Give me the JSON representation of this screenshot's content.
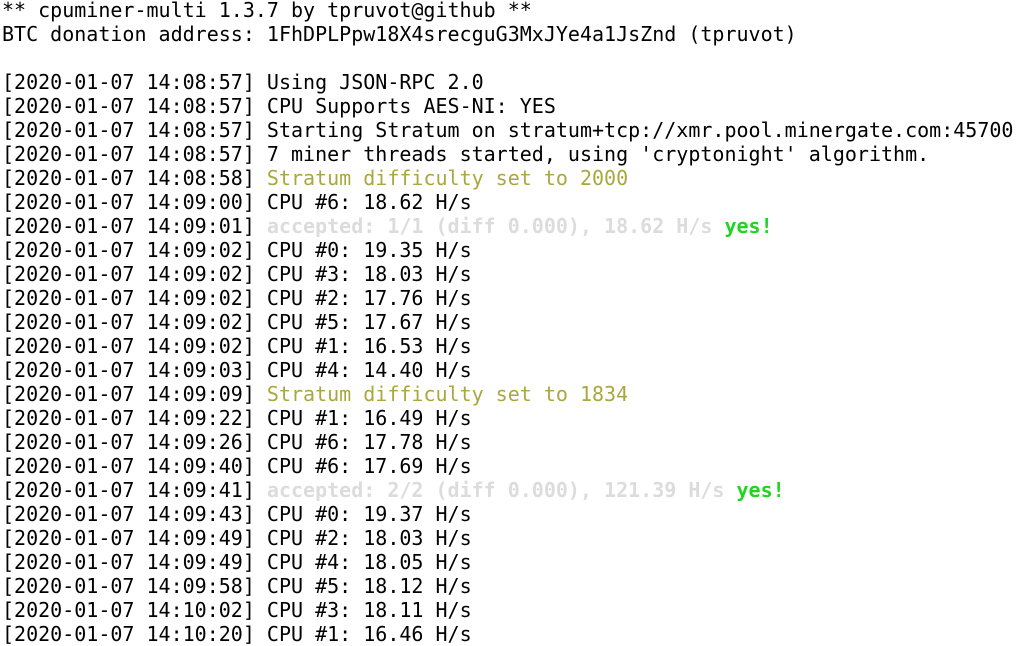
{
  "colors": {
    "normal": "#000000",
    "yellow": "#a9a73f",
    "gray": "#dcdcdc",
    "green": "#1fd51f",
    "background": "#ffffff"
  },
  "lines": [
    [
      {
        "t": "** cpuminer-multi 1.3.7 by tpruvot@github **",
        "c": "normal"
      }
    ],
    [
      {
        "t": "BTC donation address: 1FhDPLPpw18X4srecguG3MxJYe4a1JsZnd (tpruvot)",
        "c": "normal"
      }
    ],
    [],
    [
      {
        "t": "[2020-01-07 14:08:57] ",
        "c": "normal"
      },
      {
        "t": "Using JSON-RPC 2.0",
        "c": "normal"
      }
    ],
    [
      {
        "t": "[2020-01-07 14:08:57] ",
        "c": "normal"
      },
      {
        "t": "CPU Supports AES-NI: YES",
        "c": "normal"
      }
    ],
    [
      {
        "t": "[2020-01-07 14:08:57] ",
        "c": "normal"
      },
      {
        "t": "Starting Stratum on stratum+tcp://xmr.pool.minergate.com:45700",
        "c": "normal"
      }
    ],
    [
      {
        "t": "[2020-01-07 14:08:57] ",
        "c": "normal"
      },
      {
        "t": "7 miner threads started, using 'cryptonight' algorithm.",
        "c": "normal"
      }
    ],
    [
      {
        "t": "[2020-01-07 14:08:58] ",
        "c": "normal"
      },
      {
        "t": "Stratum difficulty set to 2000",
        "c": "yellow"
      }
    ],
    [
      {
        "t": "[2020-01-07 14:09:00] ",
        "c": "normal"
      },
      {
        "t": "CPU #6: 18.62 H/s",
        "c": "normal"
      }
    ],
    [
      {
        "t": "[2020-01-07 14:09:01] ",
        "c": "normal"
      },
      {
        "t": "accepted: 1/1 (diff 0.000), 18.62 H/s ",
        "c": "gray"
      },
      {
        "t": "yes!",
        "c": "green"
      }
    ],
    [
      {
        "t": "[2020-01-07 14:09:02] ",
        "c": "normal"
      },
      {
        "t": "CPU #0: 19.35 H/s",
        "c": "normal"
      }
    ],
    [
      {
        "t": "[2020-01-07 14:09:02] ",
        "c": "normal"
      },
      {
        "t": "CPU #3: 18.03 H/s",
        "c": "normal"
      }
    ],
    [
      {
        "t": "[2020-01-07 14:09:02] ",
        "c": "normal"
      },
      {
        "t": "CPU #2: 17.76 H/s",
        "c": "normal"
      }
    ],
    [
      {
        "t": "[2020-01-07 14:09:02] ",
        "c": "normal"
      },
      {
        "t": "CPU #5: 17.67 H/s",
        "c": "normal"
      }
    ],
    [
      {
        "t": "[2020-01-07 14:09:02] ",
        "c": "normal"
      },
      {
        "t": "CPU #1: 16.53 H/s",
        "c": "normal"
      }
    ],
    [
      {
        "t": "[2020-01-07 14:09:03] ",
        "c": "normal"
      },
      {
        "t": "CPU #4: 14.40 H/s",
        "c": "normal"
      }
    ],
    [
      {
        "t": "[2020-01-07 14:09:09] ",
        "c": "normal"
      },
      {
        "t": "Stratum difficulty set to 1834",
        "c": "yellow"
      }
    ],
    [
      {
        "t": "[2020-01-07 14:09:22] ",
        "c": "normal"
      },
      {
        "t": "CPU #1: 16.49 H/s",
        "c": "normal"
      }
    ],
    [
      {
        "t": "[2020-01-07 14:09:26] ",
        "c": "normal"
      },
      {
        "t": "CPU #6: 17.78 H/s",
        "c": "normal"
      }
    ],
    [
      {
        "t": "[2020-01-07 14:09:40] ",
        "c": "normal"
      },
      {
        "t": "CPU #6: 17.69 H/s",
        "c": "normal"
      }
    ],
    [
      {
        "t": "[2020-01-07 14:09:41] ",
        "c": "normal"
      },
      {
        "t": "accepted: 2/2 (diff 0.000), 121.39 H/s ",
        "c": "gray"
      },
      {
        "t": "yes!",
        "c": "green"
      }
    ],
    [
      {
        "t": "[2020-01-07 14:09:43] ",
        "c": "normal"
      },
      {
        "t": "CPU #0: 19.37 H/s",
        "c": "normal"
      }
    ],
    [
      {
        "t": "[2020-01-07 14:09:49] ",
        "c": "normal"
      },
      {
        "t": "CPU #2: 18.03 H/s",
        "c": "normal"
      }
    ],
    [
      {
        "t": "[2020-01-07 14:09:49] ",
        "c": "normal"
      },
      {
        "t": "CPU #4: 18.05 H/s",
        "c": "normal"
      }
    ],
    [
      {
        "t": "[2020-01-07 14:09:58] ",
        "c": "normal"
      },
      {
        "t": "CPU #5: 18.12 H/s",
        "c": "normal"
      }
    ],
    [
      {
        "t": "[2020-01-07 14:10:02] ",
        "c": "normal"
      },
      {
        "t": "CPU #3: 18.11 H/s",
        "c": "normal"
      }
    ],
    [
      {
        "t": "[2020-01-07 14:10:20] ",
        "c": "normal"
      },
      {
        "t": "CPU #1: 16.46 H/s",
        "c": "normal"
      }
    ]
  ]
}
